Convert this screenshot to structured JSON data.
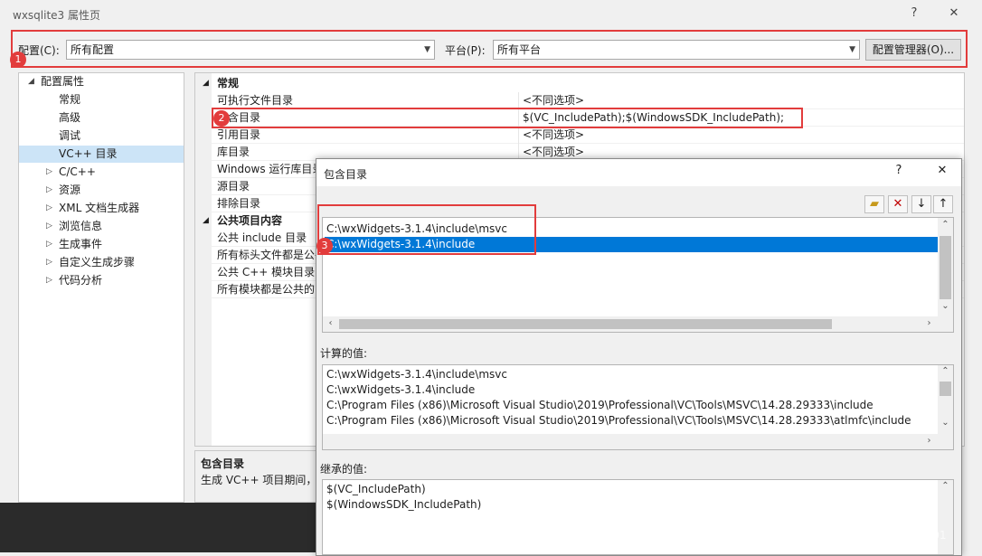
{
  "window": {
    "title": "wxsqlite3 属性页",
    "help": "?",
    "close": "✕"
  },
  "config": {
    "config_label": "配置(C):",
    "config_value": "所有配置",
    "platform_label": "平台(P):",
    "platform_value": "所有平台",
    "manager_button": "配置管理器(O)..."
  },
  "badges": [
    "1",
    "2",
    "3"
  ],
  "tree": {
    "root": "配置属性",
    "items": [
      "常规",
      "高级",
      "调试",
      "VC++ 目录",
      "C/C++",
      "资源",
      "XML 文档生成器",
      "浏览信息",
      "生成事件",
      "自定义生成步骤",
      "代码分析"
    ]
  },
  "grid": {
    "category1": "常规",
    "rows1": [
      {
        "name": "可执行文件目录",
        "value": "<不同选项>"
      },
      {
        "name": "包含目录",
        "value": "$(VC_IncludePath);$(WindowsSDK_IncludePath);"
      },
      {
        "name": "引用目录",
        "value": "<不同选项>"
      },
      {
        "name": "库目录",
        "value": "<不同选项>"
      },
      {
        "name": "Windows 运行库目录",
        "value": ""
      },
      {
        "name": "源目录",
        "value": ""
      },
      {
        "name": "排除目录",
        "value": ""
      }
    ],
    "category2": "公共项目内容",
    "rows2": [
      {
        "name": "公共 include 目录"
      },
      {
        "name": "所有标头文件都是公共的"
      },
      {
        "name": "公共 C++ 模块目录"
      },
      {
        "name": "所有模块都是公共的"
      }
    ]
  },
  "desc": {
    "title": "包含目录",
    "text": "生成 VC++ 项目期间，"
  },
  "dialog": {
    "title": "包含目录",
    "help": "?",
    "close": "✕",
    "entries": [
      "C:\\wxWidgets-3.1.4\\include\\msvc",
      "C:\\wxWidgets-3.1.4\\include"
    ],
    "computed_label": "计算的值:",
    "computed": [
      "C:\\wxWidgets-3.1.4\\include\\msvc",
      "C:\\wxWidgets-3.1.4\\include",
      "C:\\Program Files (x86)\\Microsoft Visual Studio\\2019\\Professional\\VC\\Tools\\MSVC\\14.28.29333\\include",
      "C:\\Program Files (x86)\\Microsoft Visual Studio\\2019\\Professional\\VC\\Tools\\MSVC\\14.28.29333\\atlmfc\\include"
    ],
    "inherited_label": "继承的值:",
    "inherited": [
      "$(VC_IncludePath)",
      "$(WindowsSDK_IncludePath)"
    ]
  },
  "watermark": "https://blog.csdn.net/qq_38688701",
  "colors": {
    "accent": "#0078d7",
    "highlight": "#e23c3c",
    "selected_tree": "#cce4f7"
  },
  "icons": {
    "new_line": "new-folder-icon",
    "delete": "delete-icon",
    "move_down": "arrow-down-icon",
    "move_up": "arrow-up-icon"
  }
}
